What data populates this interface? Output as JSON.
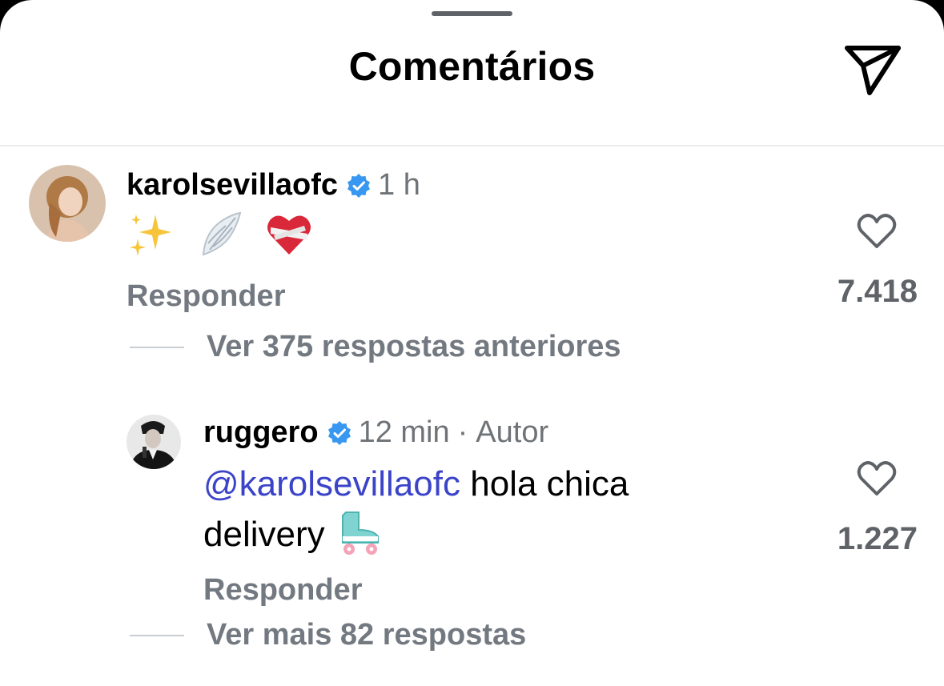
{
  "header": {
    "title": "Comentários"
  },
  "comment": {
    "username": "karolsevillaofc",
    "time": "1 h",
    "emojis": [
      "sparkles",
      "wing",
      "mended-heart"
    ],
    "reply_label": "Responder",
    "likes": "7.418",
    "view_previous": "Ver 375 respostas anteriores"
  },
  "reply": {
    "username": "ruggero",
    "time": "12 min",
    "separator": "·",
    "badge": "Autor",
    "mention": "@karolsevillaofc",
    "text_line1": " hola chica",
    "text_line2": "delivery",
    "trailing_emoji": "roller-skate",
    "reply_label": "Responder",
    "likes": "1.227",
    "view_more": "Ver mais 82 respostas"
  },
  "colors": {
    "verified": "#3897f0",
    "mention": "#3b44c9",
    "muted": "#737980"
  }
}
